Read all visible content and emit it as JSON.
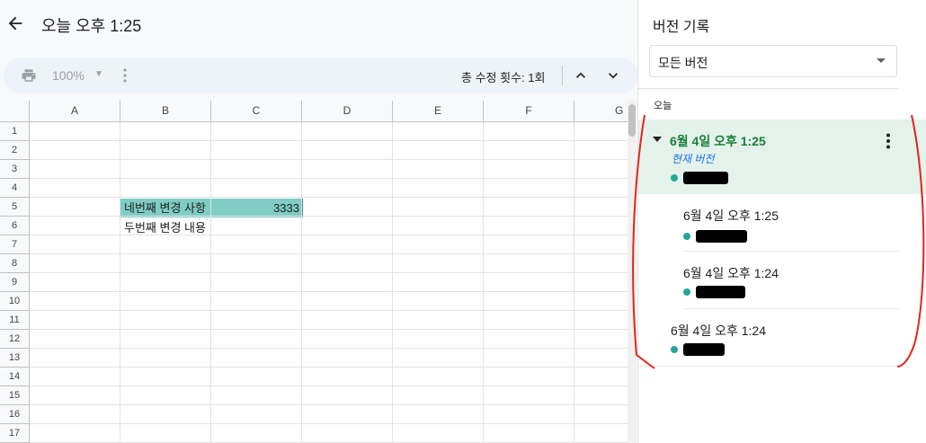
{
  "header": {
    "title": "오늘 오후 1:25"
  },
  "toolbar": {
    "zoom": "100%",
    "edit_count": "총 수정 횟수: 1회"
  },
  "sheet": {
    "columns": [
      "A",
      "B",
      "C",
      "D",
      "E",
      "F",
      "G"
    ],
    "rows": [
      "1",
      "2",
      "3",
      "4",
      "5",
      "6",
      "7",
      "8",
      "9",
      "10",
      "11",
      "12",
      "13",
      "14",
      "15",
      "16",
      "17"
    ],
    "cells": {
      "B5": "네번째 변경 사항",
      "C5": "3333",
      "B6": "두번째 변경 내용"
    },
    "highlight_color": "#7fcdc4"
  },
  "panel": {
    "title": "버전 기록",
    "filter": "모든 버전",
    "section": "오늘",
    "current_label": "현재 버전",
    "versions": [
      {
        "time": "6월 4일 오후 1:25"
      },
      {
        "time": "6월 4일 오후 1:25"
      },
      {
        "time": "6월 4일 오후 1:24"
      },
      {
        "time": "6월 4일 오후 1:24"
      }
    ],
    "accent_color": "#188038",
    "dot_color": "#26a69a"
  },
  "annotation": {
    "color": "#e3241b"
  }
}
